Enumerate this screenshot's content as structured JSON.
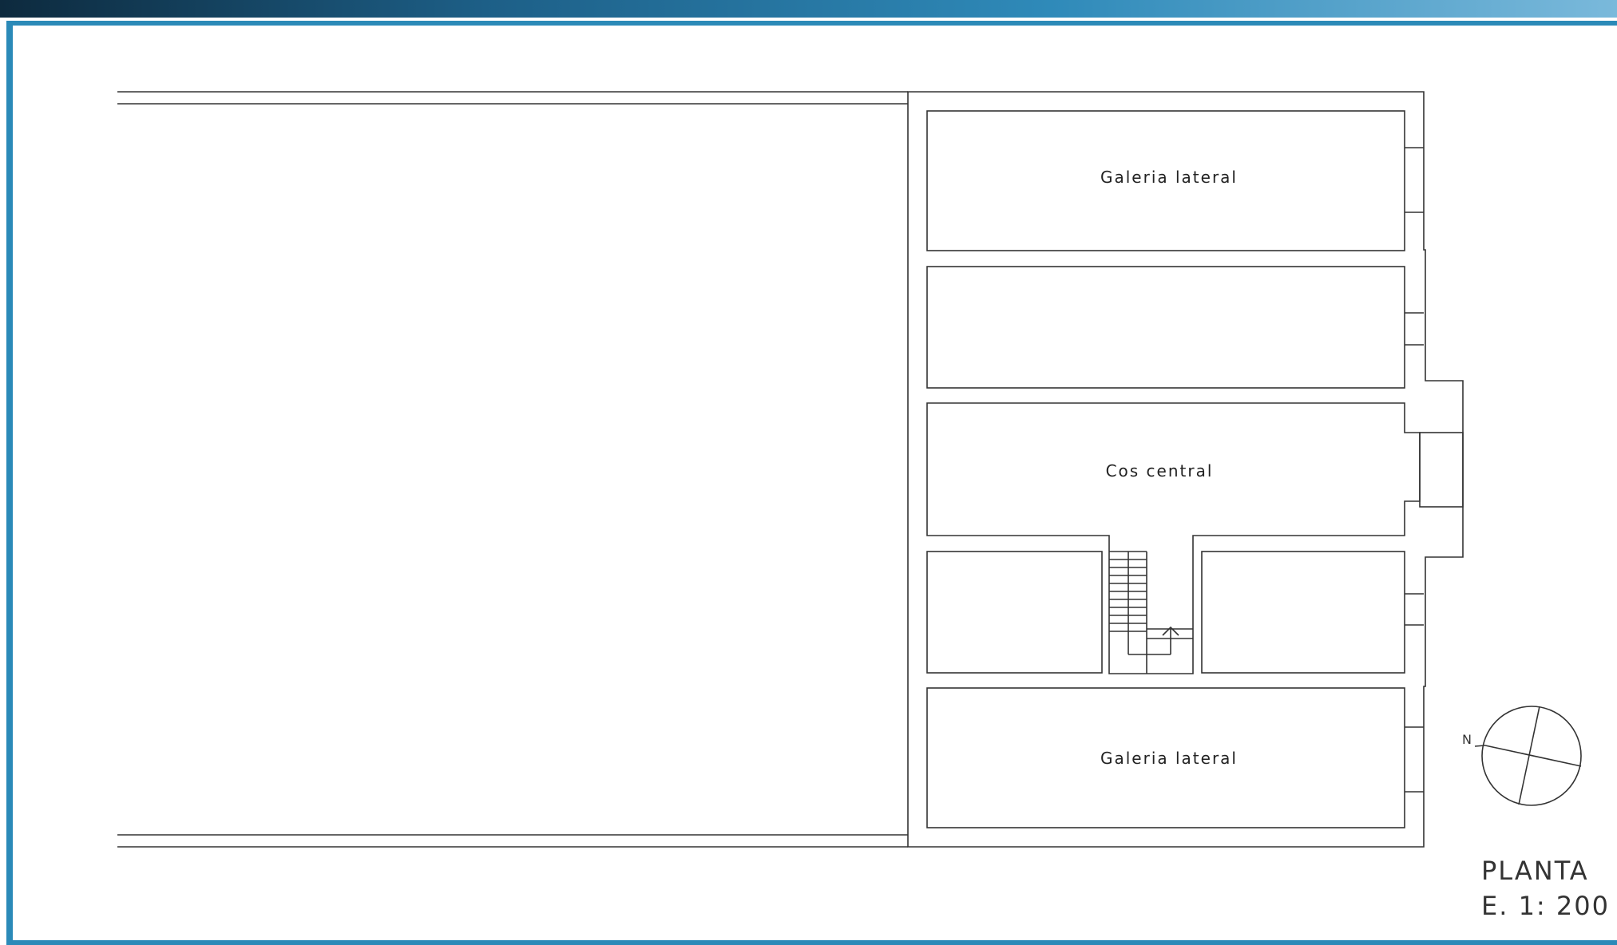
{
  "plan": {
    "rooms": {
      "gallery_top": "Galeria lateral",
      "central": "Cos central",
      "gallery_bottom": "Galeria lateral"
    },
    "north_label": "N",
    "title": "PLANTA",
    "scale": "E. 1: 200"
  },
  "colors": {
    "frame": "#2b8ab8",
    "lines": "#333333",
    "background": "#ffffff"
  }
}
